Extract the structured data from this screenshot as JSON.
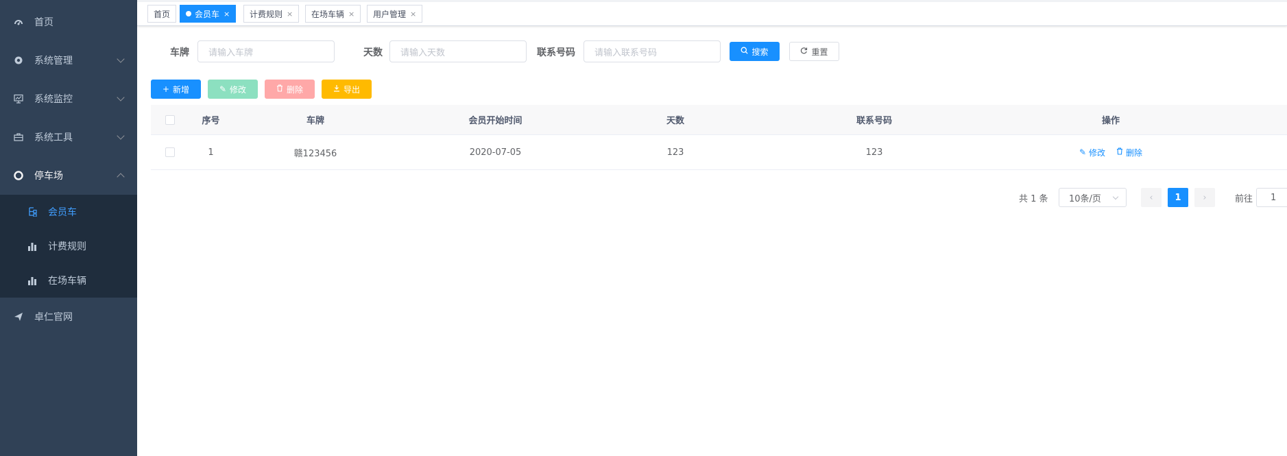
{
  "sidebar": {
    "items": [
      {
        "label": "首页",
        "icon": "dashboard-icon"
      },
      {
        "label": "系统管理",
        "icon": "gear-icon"
      },
      {
        "label": "系统监控",
        "icon": "monitor-icon"
      },
      {
        "label": "系统工具",
        "icon": "toolbox-icon"
      },
      {
        "label": "停车场",
        "icon": "lifebuoy-icon"
      }
    ],
    "submenu": [
      {
        "label": "会员车",
        "icon": "tree-icon"
      },
      {
        "label": "计费规则",
        "icon": "bar-chart-icon"
      },
      {
        "label": "在场车辆",
        "icon": "bar-chart-icon"
      }
    ],
    "footer_item": {
      "label": "卓仁官网",
      "icon": "send-icon"
    }
  },
  "tags": [
    {
      "label": "首页"
    },
    {
      "label": "会员车"
    },
    {
      "label": "计费规则"
    },
    {
      "label": "在场车辆"
    },
    {
      "label": "用户管理"
    }
  ],
  "search": {
    "plate_label": "车牌",
    "plate_placeholder": "请输入车牌",
    "days_label": "天数",
    "days_placeholder": "请输入天数",
    "phone_label": "联系号码",
    "phone_placeholder": "请输入联系号码",
    "search_btn": "搜索",
    "reset_btn": "重置"
  },
  "toolbar": {
    "add": "新增",
    "edit": "修改",
    "delete": "删除",
    "export": "导出"
  },
  "table": {
    "headers": [
      "序号",
      "车牌",
      "会员开始时间",
      "天数",
      "联系号码",
      "操作"
    ],
    "rows": [
      {
        "index": "1",
        "plate": "赣123456",
        "start": "2020-07-05",
        "days": "123",
        "phone": "123",
        "edit": "修改",
        "delete": "删除"
      }
    ]
  },
  "pagination": {
    "total": "共 1 条",
    "page_size": "10条/页",
    "current": "1",
    "goto_label": "前往",
    "goto_value": "1"
  },
  "colors": {
    "sidebar_bg": "#304156",
    "submenu_bg": "#1f2d3d",
    "primary": "#1890ff",
    "warning": "#ffba00"
  }
}
